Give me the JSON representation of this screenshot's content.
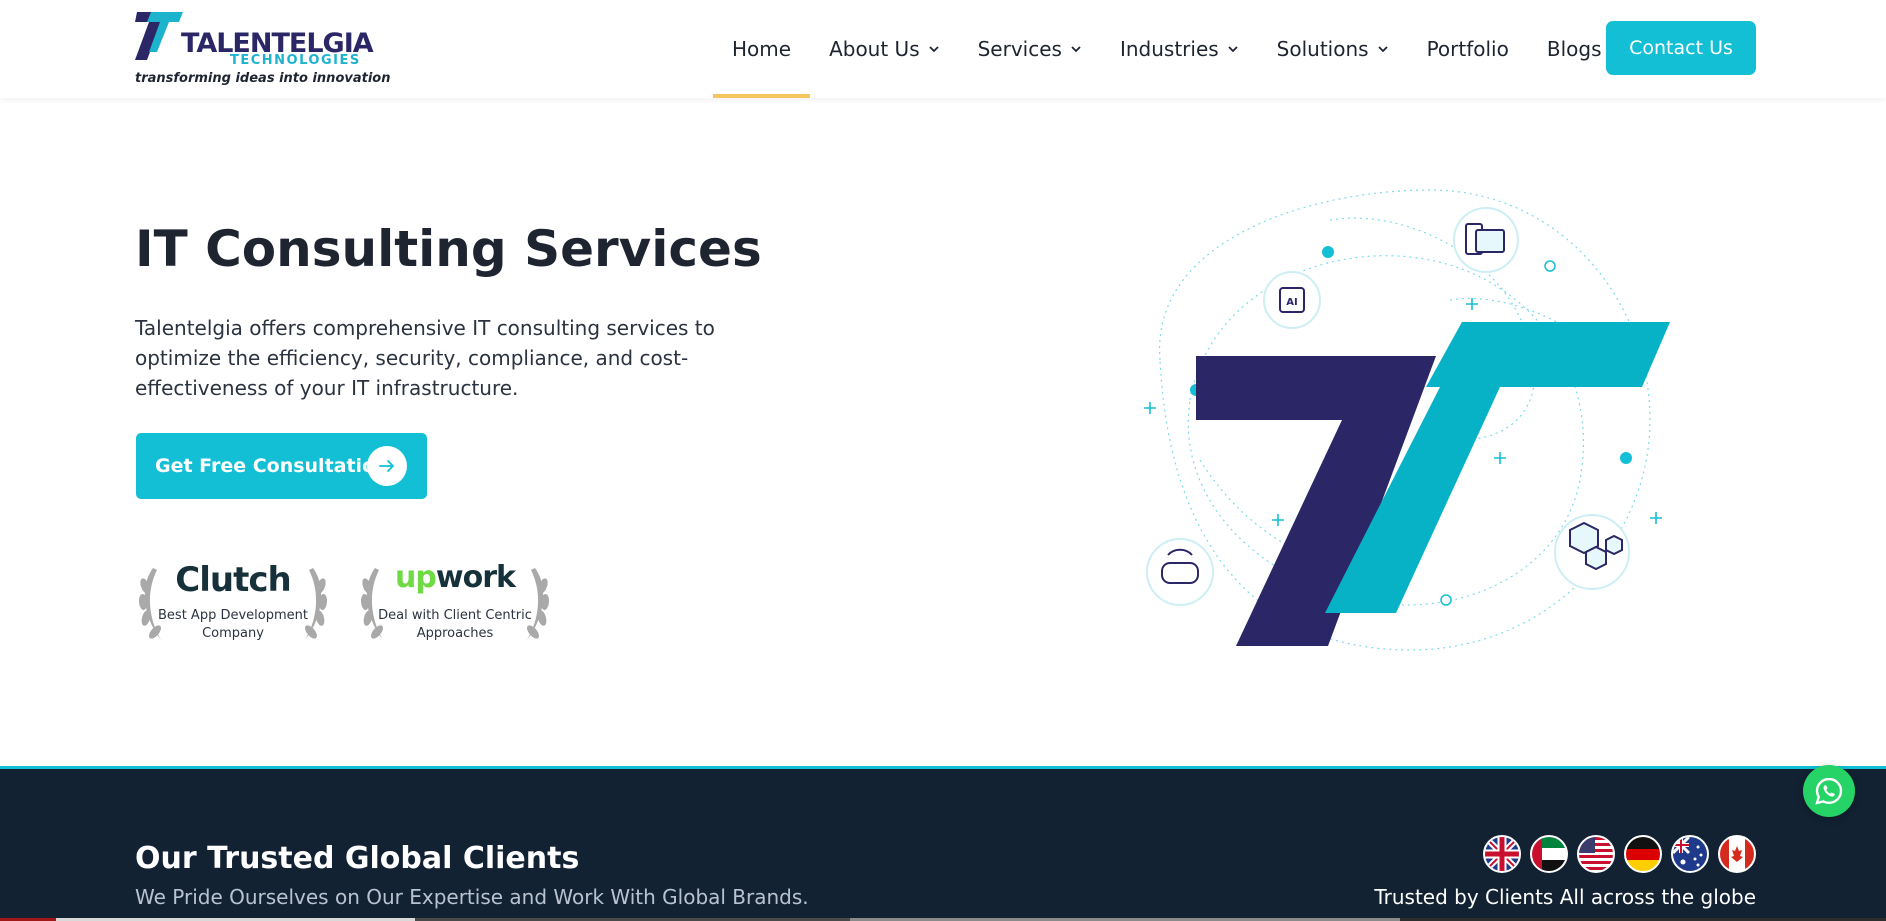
{
  "header": {
    "logo": {
      "name": "TALENTELGIA",
      "subtitle": "TECHNOLOGIES",
      "tagline": "transforming ideas into innovation"
    },
    "nav": [
      {
        "label": "Home",
        "active": true,
        "dropdown": false
      },
      {
        "label": "About Us",
        "active": false,
        "dropdown": true
      },
      {
        "label": "Services",
        "active": false,
        "dropdown": true
      },
      {
        "label": "Industries",
        "active": false,
        "dropdown": true
      },
      {
        "label": "Solutions",
        "active": false,
        "dropdown": true
      },
      {
        "label": "Portfolio",
        "active": false,
        "dropdown": false
      },
      {
        "label": "Blogs",
        "active": false,
        "dropdown": false
      }
    ],
    "contact_label": "Contact Us"
  },
  "hero": {
    "title": "IT Consulting Services",
    "description": "Talentelgia offers comprehensive IT consulting services to optimize the efficiency, security, compliance, and cost-effectiveness of your IT infrastructure.",
    "cta_label": "Get Free Consultation",
    "badges": [
      {
        "brand": "Clutch",
        "caption": "Best App Development Company"
      },
      {
        "brand_up": "up",
        "brand_rest": "work",
        "caption": "Deal with Client Centric Approaches"
      }
    ],
    "illustration_icons": [
      "ai-chip-icon",
      "devices-icon",
      "vr-headset-icon",
      "cubes-icon"
    ]
  },
  "clients": {
    "title": "Our Trusted Global Clients",
    "subtitle": "We Pride Ourselves on Our Expertise and Work With Global Brands.",
    "right_text": "Trusted by Clients All across the globe",
    "flags": [
      "uk",
      "uae",
      "usa",
      "germany",
      "australia",
      "canada"
    ]
  },
  "colors": {
    "accent": "#13bfd4",
    "navy": "#2b2766",
    "nav_underline": "#f7c55e",
    "dark_band": "#122233",
    "whatsapp": "#25d366"
  }
}
